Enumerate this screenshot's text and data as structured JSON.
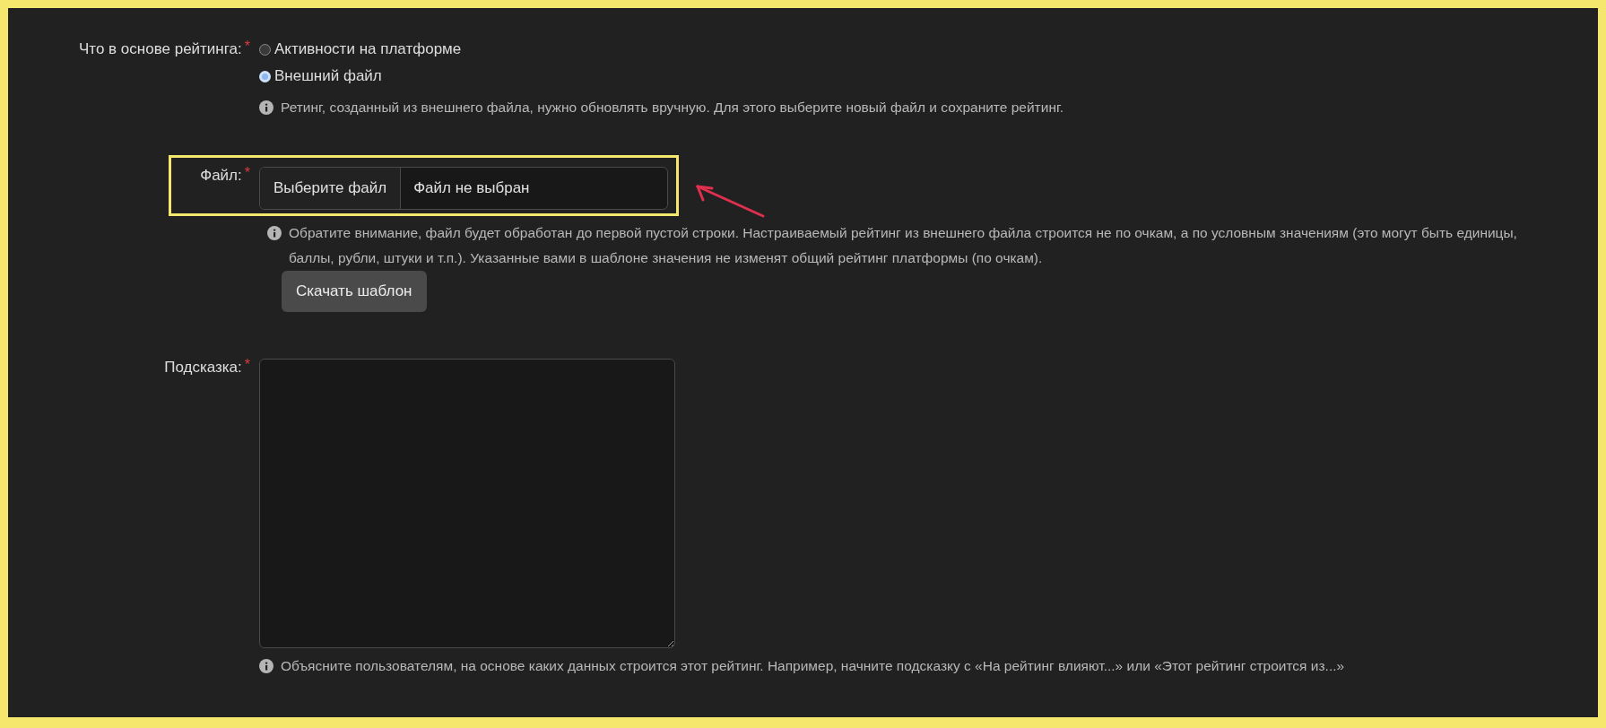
{
  "basis": {
    "label": "Что в основе рейтинга:",
    "required": true,
    "required_mark": "*",
    "options": [
      {
        "label": "Активности на платформе",
        "selected": false
      },
      {
        "label": "Внешний файл",
        "selected": true
      }
    ],
    "hint": "Ретинг, созданный из внешнего файла, нужно обновлять вручную. Для этого выберите новый файл и сохраните рейтинг."
  },
  "file": {
    "label": "Файл:",
    "required": true,
    "required_mark": "*",
    "button": "Выберите файл",
    "value": "Файл не выбран",
    "hint": "Обратите внимание, файл будет обработан до первой пустой строки. Настраиваемый рейтинг из внешнего файла строится не по очкам, а по условным значениям (это могут быть единицы, баллы, рубли, штуки и т.п.). Указанные вами в шаблоне значения не изменят общий рейтинг платформы (по очкам).",
    "download_button": "Скачать шаблон"
  },
  "tooltip": {
    "label": "Подсказка:",
    "required": true,
    "required_mark": "*",
    "hint": "Объясните пользователям, на основе каких данных строится этот рейтинг. Например, начните подсказку с «На рейтинг влияют...» или «Этот рейтинг строится из...»"
  }
}
